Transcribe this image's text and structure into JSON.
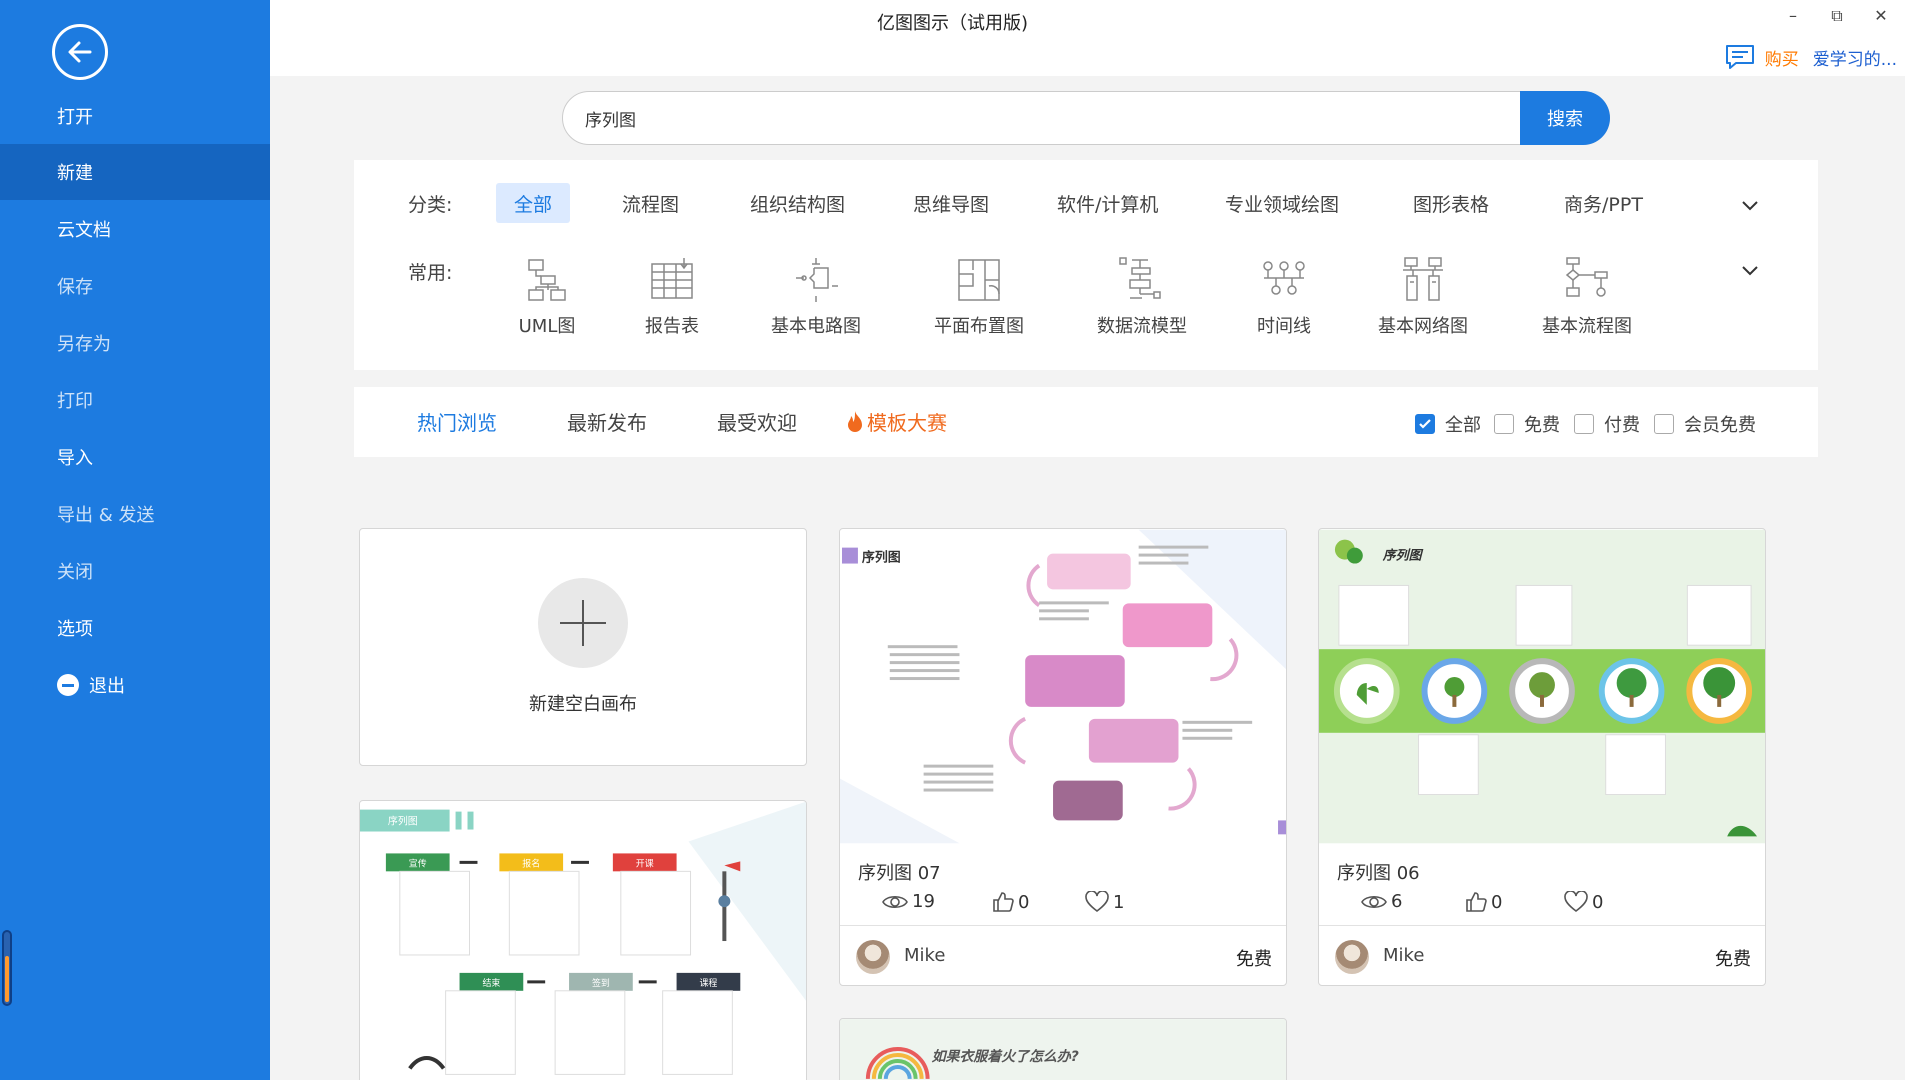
{
  "app": {
    "title": "亿图图示（试用版)"
  },
  "window": {
    "minimize": "–",
    "restore": "⧉",
    "close": "✕"
  },
  "topbar": {
    "buy": "购买",
    "user": "爱学习的..."
  },
  "sidebar": {
    "items": [
      {
        "label": "打开"
      },
      {
        "label": "新建"
      },
      {
        "label": "云文档"
      },
      {
        "label": "保存"
      },
      {
        "label": "另存为"
      },
      {
        "label": "打印"
      },
      {
        "label": "导入"
      },
      {
        "label": "导出 & 发送"
      },
      {
        "label": "关闭"
      },
      {
        "label": "选项"
      },
      {
        "label": "退出"
      }
    ]
  },
  "search": {
    "value": "序列图",
    "button": "搜索"
  },
  "categories": {
    "label": "分类:",
    "items": [
      "全部",
      "流程图",
      "组织结构图",
      "思维导图",
      "软件/计算机",
      "专业领域绘图",
      "图形表格",
      "商务/PPT"
    ]
  },
  "frequent": {
    "label": "常用:",
    "items": [
      {
        "label": "UML图",
        "icon": "uml-icon"
      },
      {
        "label": "报告表",
        "icon": "report-icon"
      },
      {
        "label": "基本电路图",
        "icon": "circuit-icon"
      },
      {
        "label": "平面布置图",
        "icon": "floorplan-icon"
      },
      {
        "label": "数据流模型",
        "icon": "dataflow-icon"
      },
      {
        "label": "时间线",
        "icon": "timeline-icon"
      },
      {
        "label": "基本网络图",
        "icon": "network-icon"
      },
      {
        "label": "基本流程图",
        "icon": "flowchart-icon"
      }
    ]
  },
  "tabs": [
    "热门浏览",
    "最新发布",
    "最受欢迎",
    "模板大赛"
  ],
  "filters": [
    {
      "label": "全部",
      "checked": true
    },
    {
      "label": "免费",
      "checked": false
    },
    {
      "label": "付费",
      "checked": false
    },
    {
      "label": "会员免费",
      "checked": false
    }
  ],
  "new_canvas": {
    "label": "新建空白画布"
  },
  "templates": [
    {
      "title": "序列图 07",
      "thumb_title": "序列图",
      "views": "19",
      "likes": "0",
      "favorites": "1",
      "author": "Mike",
      "price": "免费"
    },
    {
      "title": "序列图 06",
      "thumb_title": "序列图",
      "views": "6",
      "likes": "0",
      "favorites": "0",
      "author": "Mike",
      "price": "免费"
    }
  ],
  "partial_cards": {
    "left_thumb_title": "序列图",
    "bottom_thumb_title": "如果衣服着火了怎么办?",
    "steps_top": [
      "宣传",
      "报名",
      "开课"
    ],
    "steps_bottom": [
      "结束",
      "签到",
      "课程"
    ]
  },
  "colors": {
    "accent": "#1d7be0",
    "sidebar": "#1d7be0",
    "hot": "#f06a1e",
    "buy": "#ff7a00"
  }
}
